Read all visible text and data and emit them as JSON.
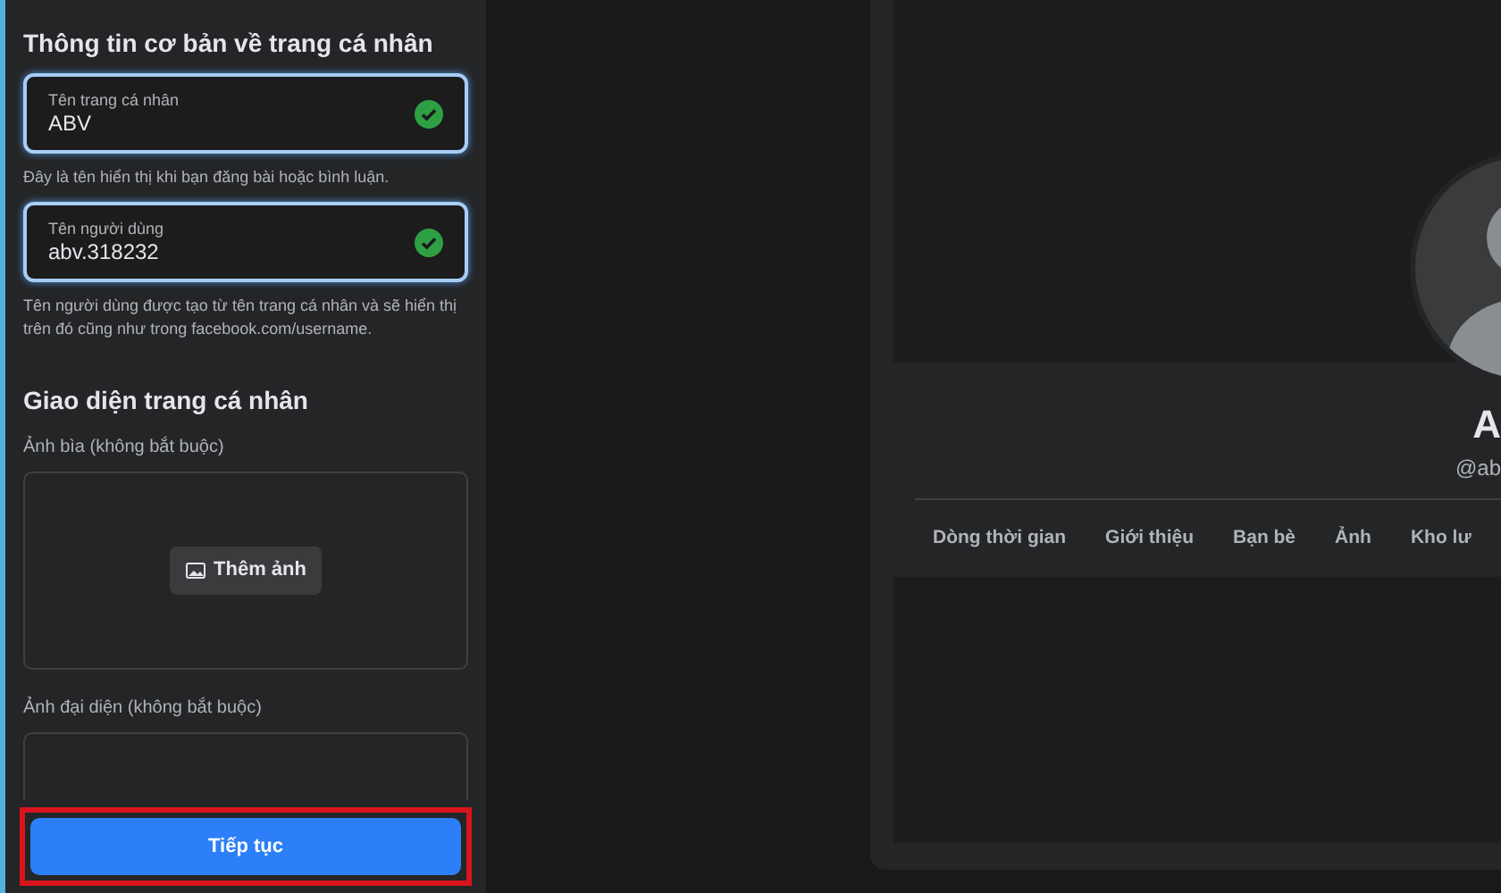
{
  "form": {
    "basic_heading": "Thông tin cơ bản về trang cá nhân",
    "fields": [
      {
        "label": "Tên trang cá nhân",
        "value": "ABV",
        "valid": true,
        "focused": true,
        "help": "Đây là tên hiển thị khi bạn đăng bài hoặc bình luận."
      },
      {
        "label": "Tên người dùng",
        "value": "abv.318232",
        "valid": true,
        "focused": true,
        "help": "Tên người dùng được tạo từ tên trang cá nhân và sẽ hiển thị trên đó cũng như trong facebook.com/username."
      }
    ],
    "appearance_heading": "Giao diện trang cá nhân",
    "cover": {
      "label": "Ảnh bìa (không bắt buộc)",
      "button": "Thêm ảnh"
    },
    "avatar": {
      "label": "Ảnh đại diện (không bắt buộc)"
    },
    "continue_button": "Tiếp tục"
  },
  "preview": {
    "name": "A",
    "username": "@ab",
    "tabs": [
      {
        "label": "Dòng thời gian"
      },
      {
        "label": "Giới thiệu"
      },
      {
        "label": "Bạn bè"
      },
      {
        "label": "Ảnh"
      },
      {
        "label": "Kho lư"
      }
    ]
  }
}
